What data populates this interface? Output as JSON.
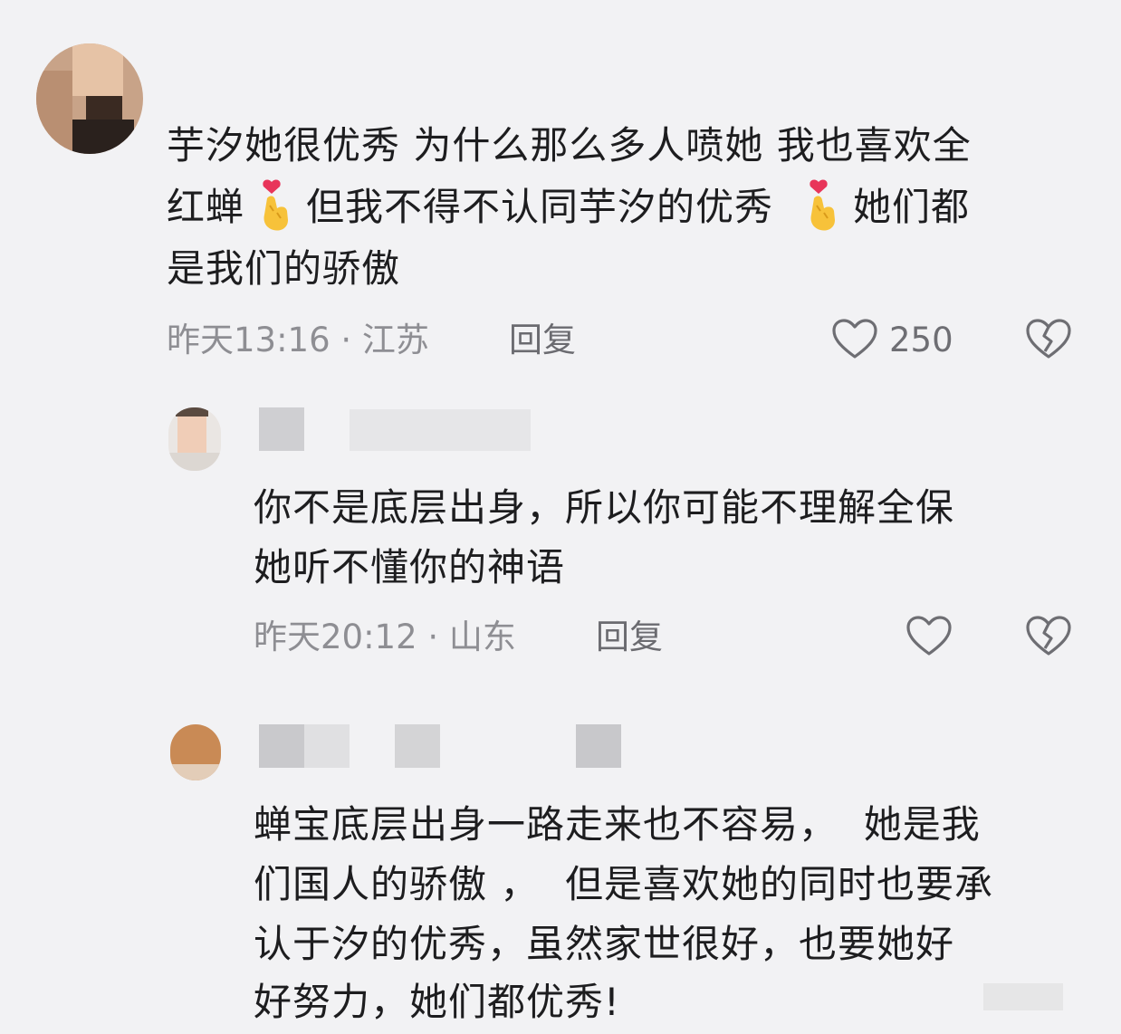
{
  "comments": [
    {
      "lines": [
        "芋汐她很优秀 为什么那么多人喷她 我也喜欢全",
        "红蝉",
        "但我不得不认同芋汐的优秀",
        "她们都",
        "是我们的骄傲"
      ],
      "emoji": "finger-heart-emoji",
      "meta": "昨天13:16 · 江苏",
      "reply": "回复",
      "likes": "250"
    },
    {
      "lines": [
        "你不是底层出身，所以你可能不理解全保",
        "她听不懂你的神语"
      ],
      "meta": "昨天20:12 · 山东",
      "reply": "回复"
    },
    {
      "lines": [
        "蝉宝底层出身一路走来也不容易，  她是我",
        "们国人的骄傲 ，  但是喜欢她的同时也要承",
        "认于汐的优秀，虽然家世很好，也要她好",
        "好努力，她们都优秀!"
      ]
    }
  ],
  "colors": {
    "background": "#f2f2f4",
    "text": "#1d1d1f",
    "meta": "#8e8e93",
    "heart_emoji": "#e8355a",
    "hand_emoji": "#f7c23a"
  }
}
